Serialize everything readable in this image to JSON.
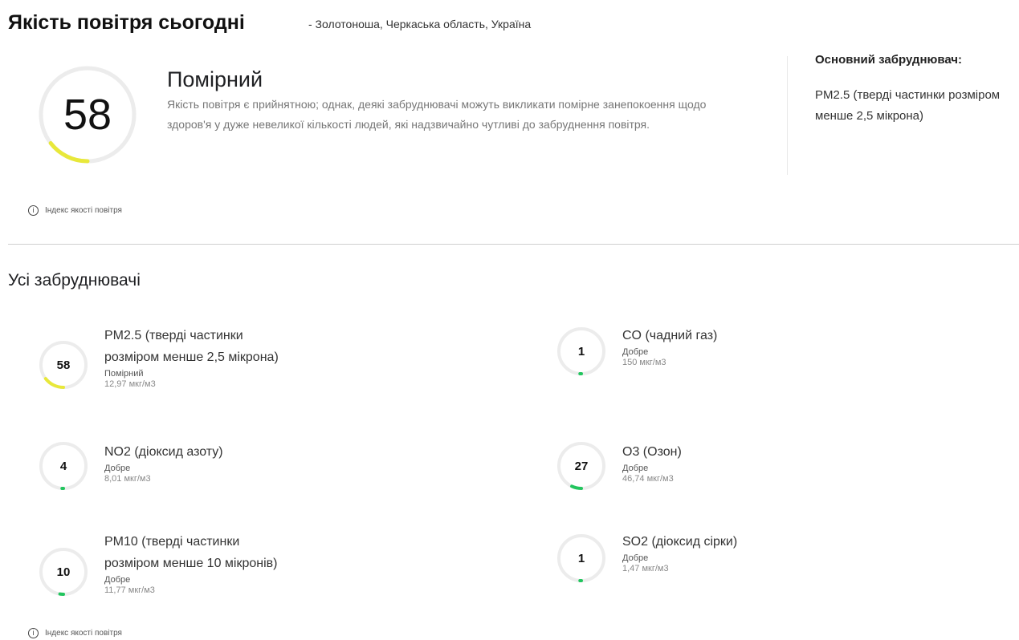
{
  "header": {
    "title": "Якість повітря сьогодні",
    "location": "- Золотоноша, Черкаська область, Україна"
  },
  "summary": {
    "aqi": "58",
    "aqi_fraction": 0.145,
    "aqi_color": "#e8e83a",
    "category": "Помірний",
    "description": "Якість повітря є прийнятною; однак, деякі забруднювачі можуть викликати помірне занепокоення щодо здоров'я у дуже невеликої кількості людей, які надзвичайно чутливі до забруднення повітря.",
    "main_pollutant_title": "Основний забруднювач:",
    "main_pollutant_value": "PM2.5 (тверді частинки розміром менше 2,5 мікрона)"
  },
  "links": {
    "aqi_info": "Індекс якості повітря",
    "info_icon": "info-circle-icon"
  },
  "pollutants_section": {
    "title": "Усі забруднювачі",
    "items": [
      {
        "name_line1": "PM2.5 (тверді частинки",
        "name_line2": "розміром менше 2,5 мікрона)",
        "index": "58",
        "status": "Помірний",
        "concentration": "12,97 мкг/м3",
        "fraction": 0.145,
        "color": "#e8e83a"
      },
      {
        "name_line1": "CO (чадний газ)",
        "name_line2": "",
        "index": "1",
        "status": "Добре",
        "concentration": "150 мкг/м3",
        "fraction": 0.01,
        "color": "#22c55e"
      },
      {
        "name_line1": "NO2 (діоксид азоту)",
        "name_line2": "",
        "index": "4",
        "status": "Добре",
        "concentration": "8,01 мкг/м3",
        "fraction": 0.01,
        "color": "#22c55e"
      },
      {
        "name_line1": "O3 (Озон)",
        "name_line2": "",
        "index": "27",
        "status": "Добре",
        "concentration": "46,74 мкг/м3",
        "fraction": 0.07,
        "color": "#22c55e"
      },
      {
        "name_line1": "PM10 (тверді частинки",
        "name_line2": "розміром менше 10 мікронів)",
        "index": "10",
        "status": "Добре",
        "concentration": "11,77 мкг/м3",
        "fraction": 0.025,
        "color": "#22c55e"
      },
      {
        "name_line1": "SO2 (діоксид сірки)",
        "name_line2": "",
        "index": "1",
        "status": "Добре",
        "concentration": "1,47 мкг/м3",
        "fraction": 0.01,
        "color": "#22c55e"
      }
    ]
  }
}
